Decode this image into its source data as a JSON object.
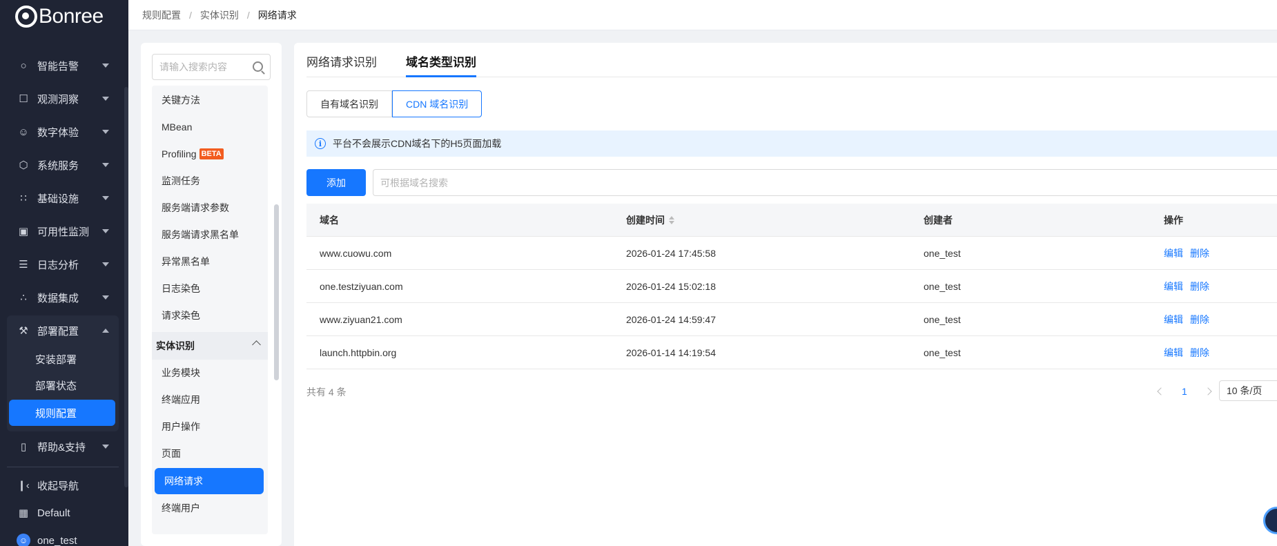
{
  "brand": {
    "name": "Bonree"
  },
  "nav": {
    "items": [
      {
        "label": "智能告警",
        "icon": "bell-icon",
        "glyph": "○"
      },
      {
        "label": "观测洞察",
        "icon": "insight-icon",
        "glyph": "☐"
      },
      {
        "label": "数字体验",
        "icon": "user-experience-icon",
        "glyph": "☺"
      },
      {
        "label": "系统服务",
        "icon": "system-service-icon",
        "glyph": "⬡"
      },
      {
        "label": "基础设施",
        "icon": "infrastructure-icon",
        "glyph": "∷"
      },
      {
        "label": "可用性监测",
        "icon": "availability-icon",
        "glyph": "▣"
      },
      {
        "label": "日志分析",
        "icon": "log-icon",
        "glyph": "☰"
      },
      {
        "label": "数据集成",
        "icon": "data-integration-icon",
        "glyph": "∴"
      },
      {
        "label": "部署配置",
        "icon": "wrench-icon",
        "glyph": "⚒"
      },
      {
        "label": "帮助&支持",
        "icon": "book-icon",
        "glyph": "▯"
      }
    ],
    "sub_items": [
      {
        "label": "安装部署"
      },
      {
        "label": "部署状态"
      },
      {
        "label": "规则配置"
      }
    ],
    "collapse_label": "收起导航",
    "workspace_label": "Default",
    "user_label": "one_test"
  },
  "breadcrumb": [
    "规则配置",
    "实体识别",
    "网络请求"
  ],
  "sidebar_search": {
    "placeholder": "请输入搜索内容"
  },
  "tree": {
    "items_top": [
      "关键方法",
      "MBean",
      "Profiling",
      "监测任务",
      "服务端请求参数",
      "服务端请求黑名单",
      "异常黑名单",
      "日志染色",
      "请求染色"
    ],
    "beta_label": "BETA",
    "group_label": "实体识别",
    "items_group": [
      "业务模块",
      "终端应用",
      "用户操作",
      "页面",
      "网络请求",
      "终端用户"
    ]
  },
  "tabs": [
    "网络请求识别",
    "域名类型识别"
  ],
  "segments": [
    "自有域名识别",
    "CDN 域名识别"
  ],
  "notice": "平台不会展示CDN域名下的H5页面加载",
  "toolbar": {
    "add_label": "添加",
    "search_placeholder": "可根据域名搜索"
  },
  "table": {
    "columns": [
      "域名",
      "创建时间",
      "创建者",
      "操作"
    ],
    "rows": [
      {
        "domain": "www.cuowu.com",
        "created": "2026-01-24 17:45:58",
        "creator": "one_test"
      },
      {
        "domain": "one.testziyuan.com",
        "created": "2026-01-24 15:02:18",
        "creator": "one_test"
      },
      {
        "domain": "www.ziyuan21.com",
        "created": "2026-01-24 14:59:47",
        "creator": "one_test"
      },
      {
        "domain": "launch.httpbin.org",
        "created": "2026-01-14 14:19:54",
        "creator": "one_test"
      }
    ],
    "edit_label": "编辑",
    "delete_label": "删除"
  },
  "pagination": {
    "total_text": "共有 4 条",
    "current_page": "1",
    "page_size": "10 条/页"
  },
  "colors": {
    "accent": "#1677ff",
    "nav_bg": "#1f2434",
    "beta": "#f25c1f"
  }
}
